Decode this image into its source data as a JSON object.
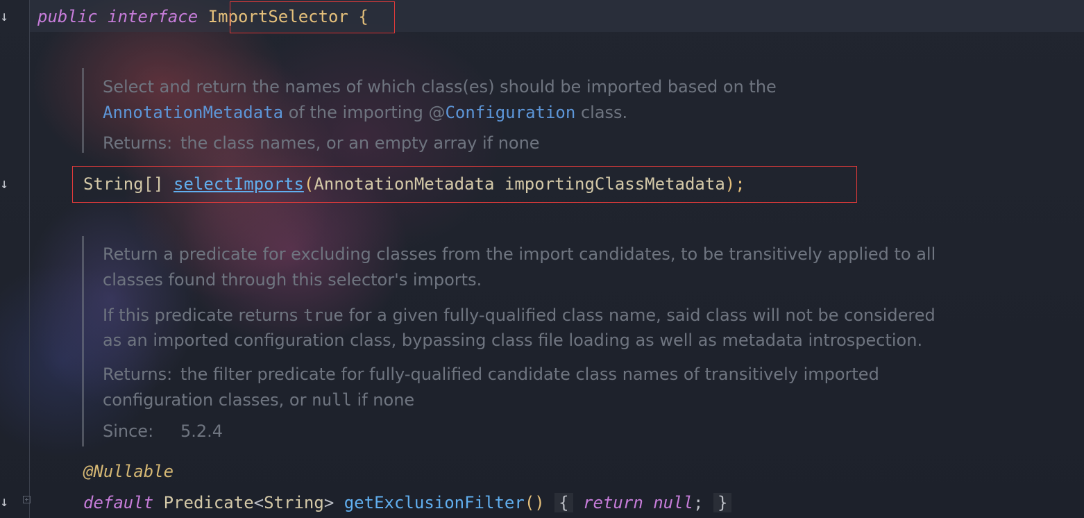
{
  "editor": {
    "line1": {
      "kw_public": "public",
      "kw_interface": "interface",
      "class_name": "ImportSelector",
      "open_brace": "{"
    },
    "doc1": {
      "l1": "Select and return the names of which class(es) should be imported based on the",
      "l2_link1": "AnnotationMetadata",
      "l2_mid": " of the importing @",
      "l2_link2": "Configuration",
      "l2_end": " class.",
      "returns_tag": "Returns:",
      "returns_text": "the class names, or an empty array if none"
    },
    "method1": {
      "return_type": "String[]",
      "name": "selectImports",
      "open_paren": "(",
      "param_type": "AnnotationMetadata",
      "param_name": "importingClassMetadata",
      "close": ");"
    },
    "doc2": {
      "p1_l1": "Return a predicate for excluding classes from the import candidates, to be transitively applied to all",
      "p1_l2": "classes found through this selector's imports.",
      "p2_l1_a": "If this predicate returns ",
      "p2_l1_code": "true",
      "p2_l1_b": " for a given fully-qualified class name, said class will not be considered",
      "p2_l2": "as an imported configuration class, bypassing class file loading as well as metadata introspection.",
      "returns_tag": "Returns:",
      "returns_l1": "the filter predicate for fully-qualified candidate class names of transitively imported",
      "returns_l2_a": "configuration classes, or ",
      "returns_l2_code": "null",
      "returns_l2_b": " if none",
      "since_tag": "Since:",
      "since_value": "5.2.4"
    },
    "annotation": "@Nullable",
    "method2": {
      "kw_default": "default",
      "return_type": "Predicate",
      "generic_open": "<",
      "generic_type": "String",
      "generic_close": ">",
      "name": "getExclusionFilter",
      "parens": "()",
      "open_brace": "{",
      "kw_return": "return",
      "kw_null": "null",
      "semicolon": ";",
      "close_brace": "}"
    },
    "gutter": {
      "implement_icon": "↓"
    }
  },
  "colors": {
    "highlight_box": "#e03a3a",
    "keyword": "#c77dda",
    "class": "#e5c07b",
    "function": "#61afef",
    "doc_text": "#6f7580",
    "doc_link": "#5d96d8"
  }
}
